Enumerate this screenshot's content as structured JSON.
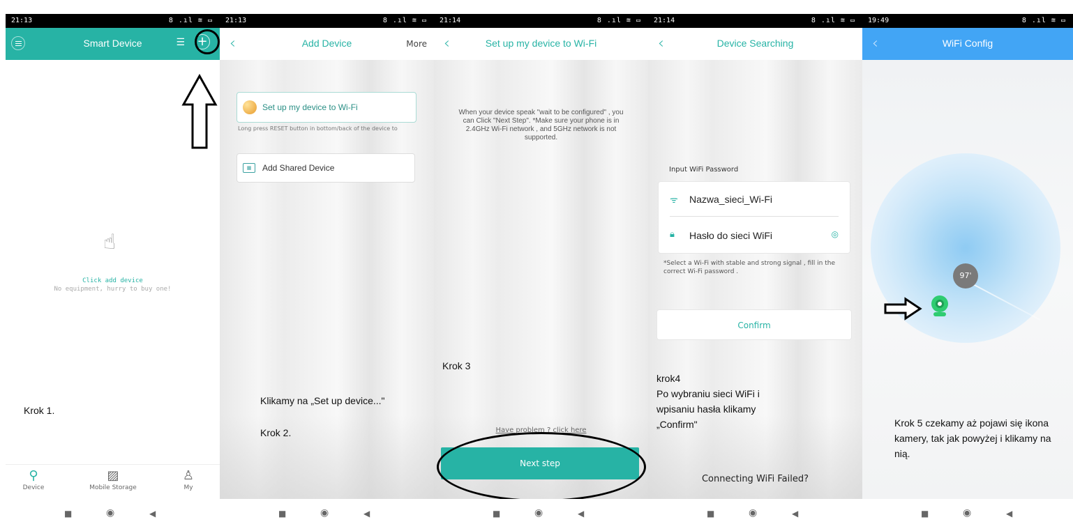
{
  "status": {
    "p1_time": "21:13",
    "p2_time": "21:13",
    "p3_time": "21:14",
    "p4_time": "21:14",
    "p5_time": "19:49",
    "icons": "8 .ıl ≋ ▭"
  },
  "panel1": {
    "title": "Smart Device",
    "empty_title": "Click add device",
    "empty_sub": "No equipment, hurry to buy one!",
    "annotation": "Krok 1.",
    "tabs": [
      {
        "label": "Device",
        "icon": "location-pin-icon"
      },
      {
        "label": "Mobile Storage",
        "icon": "image-icon"
      },
      {
        "label": "My",
        "icon": "person-icon"
      }
    ],
    "accent_color": "#27b3a5"
  },
  "panel2": {
    "title": "Add Device",
    "more": "More",
    "option1": "Set up my device to Wi-Fi",
    "hint": "Long press RESET button in bottom/back of the device to",
    "option2": "Add Shared Device",
    "annotation1": "Klikamy na „Set up device...\"",
    "annotation2": "Krok 2."
  },
  "panel3": {
    "title": "Set up my device to Wi-Fi",
    "instructions": "When your device speak \"wait to be configured\" , you can Click \"Next Step\". *Make sure your phone is in 2.4GHz Wi-Fi network , and 5GHz network is not supported.",
    "annotation": "Krok 3",
    "problem_link": "Have problem ? click here",
    "next_button": "Next step"
  },
  "panel4": {
    "title": "Device Searching",
    "section_label": "Input WiFi Password",
    "ssid": "Nazwa_sieci_Wi-Fi",
    "password": "Hasło do sieci WiFi",
    "note": "*Select a Wi-Fi with stable and strong signal , fill in the correct Wi-Fi password .",
    "confirm_button": "Confirm",
    "annotation": "krok4\nPo wybraniu sieci WiFi i wpisaniu hasła klikamy „Confirm\"",
    "failed_link": "Connecting WiFi Failed?"
  },
  "panel5": {
    "title": "WiFi Config",
    "progress": "97'",
    "annotation": "Krok 5 czekamy aż pojawi się ikona kamery, tak jak powyżej i klikamy na nią.",
    "header_color": "#42a5f5"
  },
  "navbar": {
    "square": "■",
    "circle": "◉",
    "back": "◀"
  }
}
